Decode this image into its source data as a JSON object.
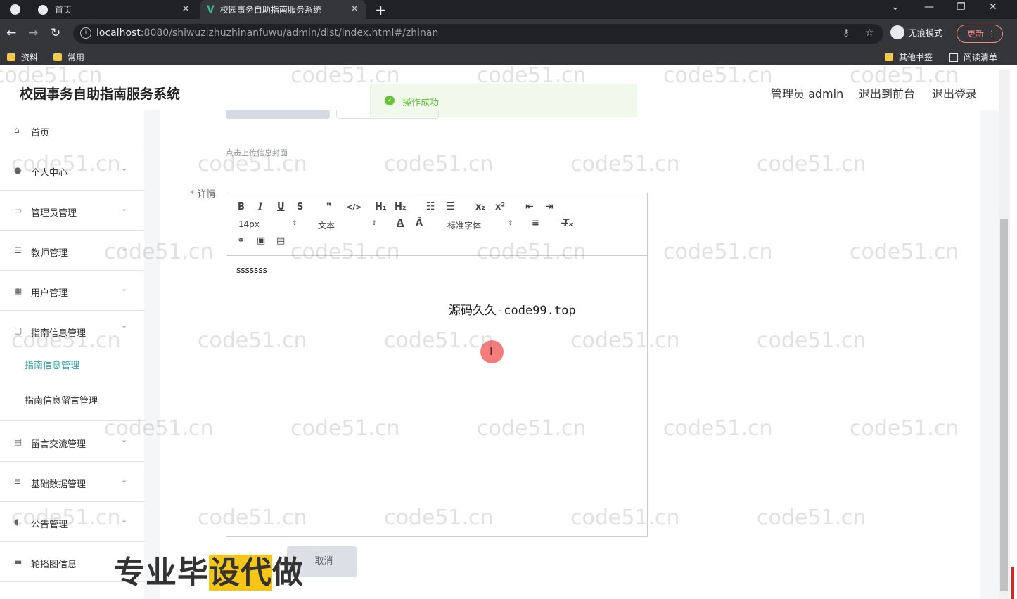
{
  "browser": {
    "tabs": [
      {
        "title": "首页"
      },
      {
        "title": "校园事务自助指南服务系统"
      }
    ],
    "new_tab": "+",
    "url_host": "localhost",
    "url_path": ":8080/shiwuzizhuzhinanfuwu/admin/dist/index.html#/zhinan",
    "incognito_label": "无痕模式",
    "update_label": "更新",
    "bookmarks": [
      {
        "label": "资料"
      },
      {
        "label": "常用"
      },
      {
        "label": "其他书签"
      },
      {
        "label": "阅读清单"
      }
    ]
  },
  "header": {
    "title": "校园事务自助指南服务系统",
    "user": "管理员 admin",
    "to_front": "退出到前台",
    "logout": "退出登录"
  },
  "toast": {
    "message": "操作成功",
    "color": "#67c23a"
  },
  "sidebar": {
    "items": [
      {
        "label": "首页",
        "icon": "home-icon"
      },
      {
        "label": "个人中心",
        "icon": "user-icon"
      },
      {
        "label": "管理员管理",
        "icon": "card-icon"
      },
      {
        "label": "教师管理",
        "icon": "sliders-icon"
      },
      {
        "label": "用户管理",
        "icon": "grid-icon"
      },
      {
        "label": "指南信息管理",
        "icon": "chat-icon"
      },
      {
        "label": "留言交流管理",
        "icon": "clipboard-icon"
      },
      {
        "label": "基础数据管理",
        "icon": "list-icon"
      },
      {
        "label": "公告管理",
        "icon": "mic-icon"
      },
      {
        "label": "轮播图信息",
        "icon": "monitor-icon"
      }
    ],
    "subitems": [
      {
        "label": "指南信息管理",
        "active": true
      },
      {
        "label": "指南信息留言管理",
        "active": false
      }
    ],
    "active_color": "#30a5a8"
  },
  "form": {
    "cover_hint": "点击上传信息封面",
    "detail_label": "详情",
    "required_mark": "*",
    "editor": {
      "font_size": "14px",
      "header_select": "文本",
      "font_family": "标准字体",
      "content": "sssssss"
    },
    "cancel_label": "取消"
  },
  "overlay": {
    "code_text": "源码久久-code99.top",
    "banner_a": "专业毕",
    "banner_b": "设代",
    "banner_c": "做",
    "watermark": "code51.cn"
  }
}
